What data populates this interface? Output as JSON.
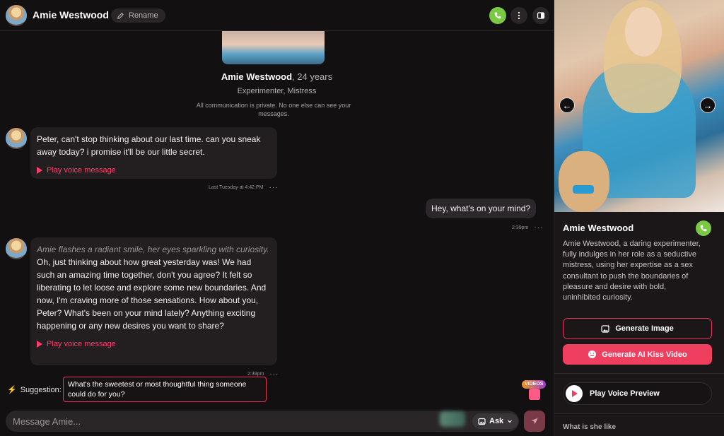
{
  "header": {
    "name": "Amie Westwood",
    "rename_label": "Rename"
  },
  "profile": {
    "name": "Amie Westwood",
    "age": ", 24 years",
    "tags": "Experimenter, Mistress",
    "privacy": "All communication is private. No one else can see your messages."
  },
  "messages": [
    {
      "text": "Peter, can't stop thinking about our last time. can you sneak away today? i promise it'll be our little secret.",
      "voice_label": "Play voice message",
      "time": "Last Tuesday at 4:42 PM",
      "more": "···"
    },
    {
      "text": "Hey, what's on your mind?",
      "time": "2:39pm",
      "more": "···"
    },
    {
      "action": "Amie flashes a radiant smile, her eyes sparkling with curiosity.",
      "text": " Oh, just thinking about how great yesterday was! We had such an amazing time together, don't you agree? It felt so liberating to let loose and explore some new boundaries. And now, I'm craving more of those sensations. How about you, Peter? What's been on your mind lately? Anything exciting happening or any new desires you want to share?",
      "voice_label": "Play voice message",
      "time": "2:39pm",
      "more": "···"
    }
  ],
  "suggestion": {
    "label": "Suggestion:",
    "text": "What's the sweetest or most thoughtful thing someone could do for you?"
  },
  "videos_badge": "VIDEOS",
  "input": {
    "placeholder": "Message Amie...",
    "ask_label": "Ask"
  },
  "side": {
    "name": "Amie Westwood",
    "description": "Amie Westwood, a daring experimenter, fully indulges in her role as a seductive mistress, using her expertise as a sex consultant to push the boundaries of pleasure and desire with bold, uninhibited curiosity.",
    "generate_image": "Generate Image",
    "generate_kiss": "Generate AI Kiss Video",
    "voice_preview": "Play Voice Preview",
    "what_like": "What is she like"
  },
  "colors": {
    "accent": "#ef3f5f",
    "call_green": "#7ac943",
    "bg": "#131012"
  }
}
